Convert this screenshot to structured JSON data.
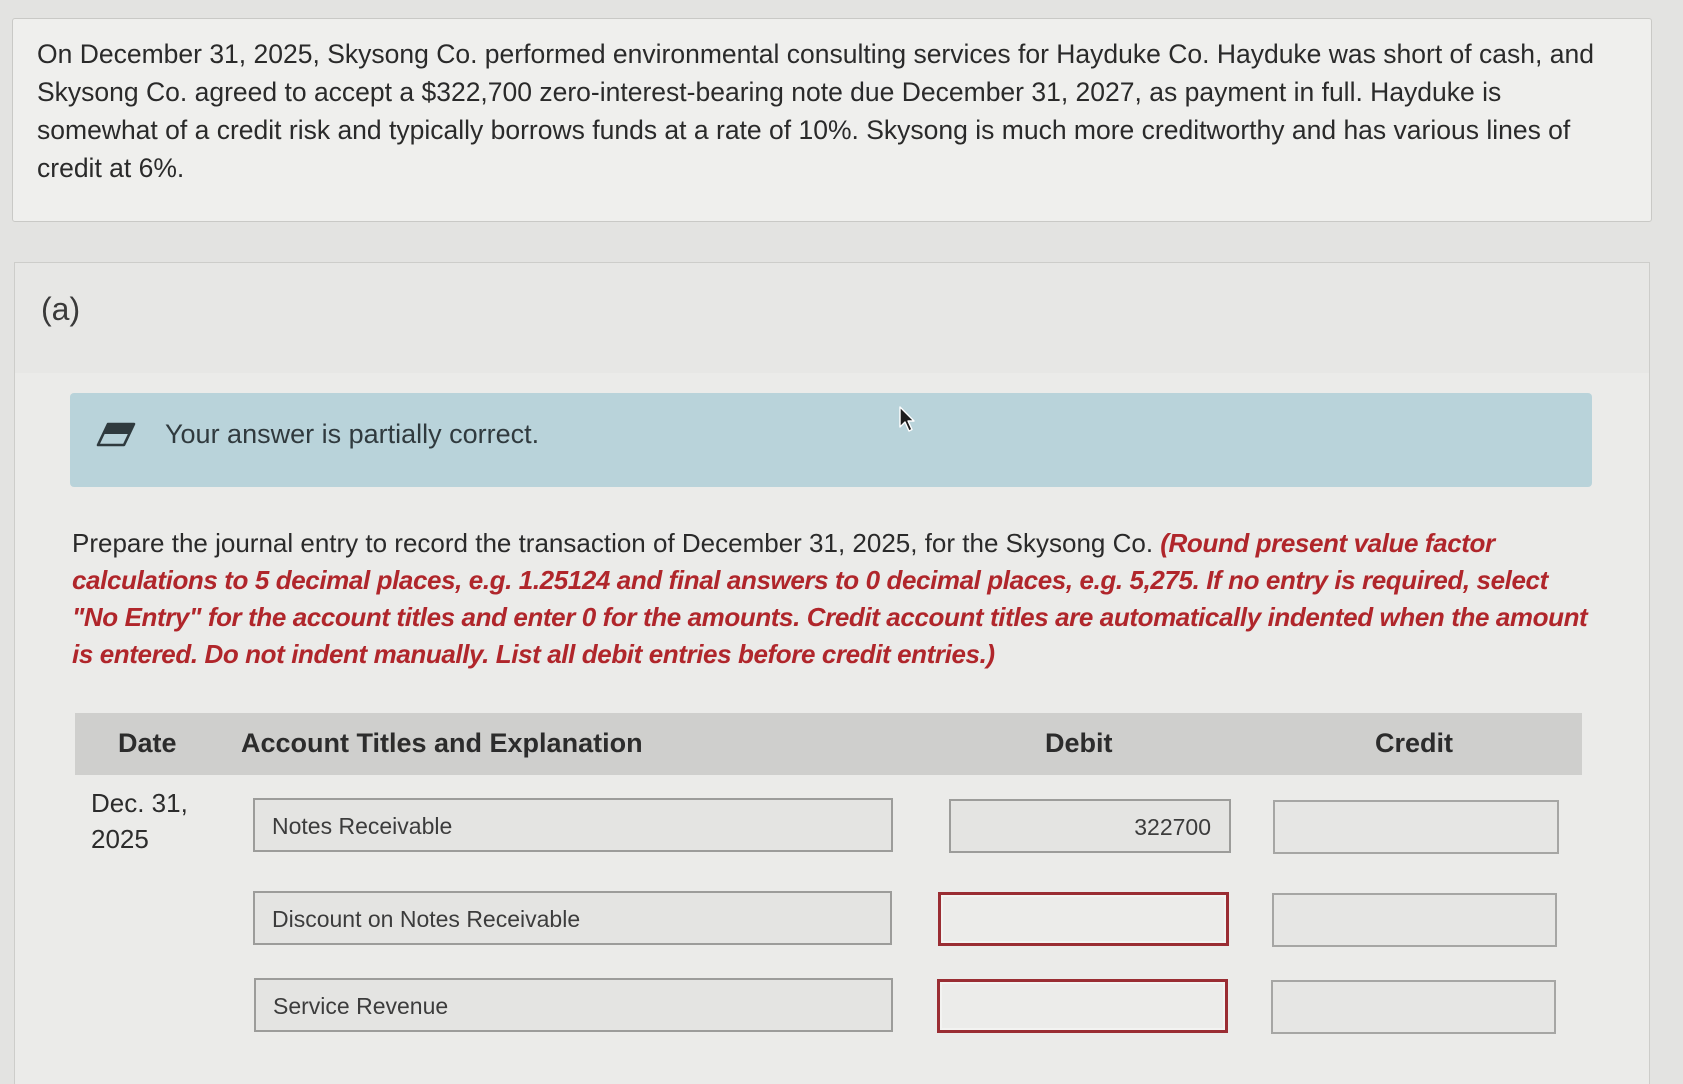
{
  "problem": {
    "text": "On December 31, 2025, Skysong Co. performed environmental consulting services for Hayduke Co. Hayduke was short of cash, and Skysong Co. agreed to accept a $322,700 zero-interest-bearing note due December 31, 2027, as payment in full. Hayduke is somewhat of a credit risk and typically borrows funds at a rate of 10%. Skysong is much more creditworthy and has various lines of credit at 6%."
  },
  "part": {
    "label": "(a)"
  },
  "status": {
    "icon": "eraser-icon",
    "text": "Your answer is partially correct."
  },
  "prompt": {
    "text": "Prepare the journal entry to record the transaction of December 31, 2025, for the Skysong Co.",
    "instructions": "(Round present value factor calculations to 5 decimal places, e.g. 1.25124 and final answers to 0 decimal places, e.g. 5,275. If no entry is required, select \"No Entry\" for the account titles and enter 0 for the amounts. Credit account titles are automatically indented when the amount is entered. Do not indent manually. List all debit entries before credit entries.)"
  },
  "table": {
    "headers": {
      "date": "Date",
      "account": "Account Titles and Explanation",
      "debit": "Debit",
      "credit": "Credit"
    },
    "date_line1": "Dec. 31,",
    "date_line2": "2025",
    "rows": [
      {
        "account": "Notes Receivable",
        "debit": "322700",
        "credit": ""
      },
      {
        "account": "Discount on Notes Receivable",
        "debit": "",
        "credit": ""
      },
      {
        "account": "Service Revenue",
        "debit": "",
        "credit": ""
      }
    ]
  },
  "colors": {
    "banner": "#b9d3da",
    "instruction_red": "#b0262b",
    "error_border": "#9a2d33"
  }
}
